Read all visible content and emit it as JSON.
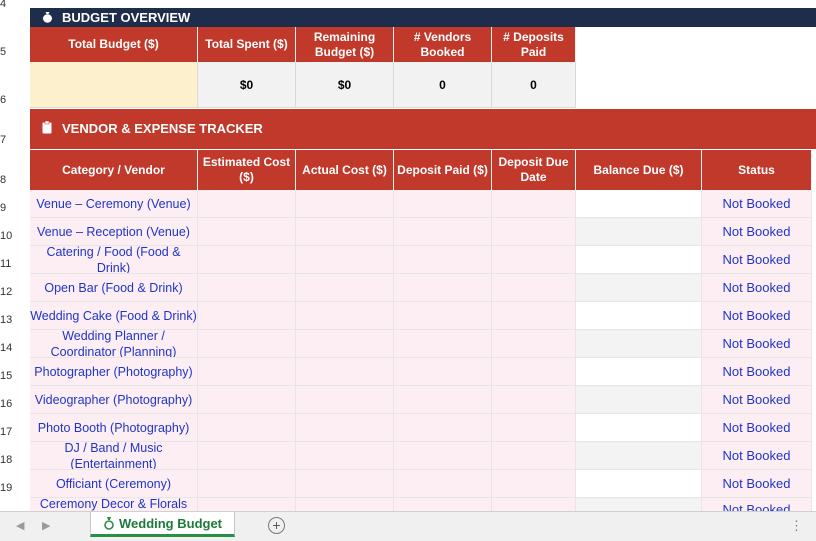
{
  "row_numbers": [
    "4",
    "5",
    "6",
    "7",
    "8",
    "9",
    "10",
    "11",
    "12",
    "13",
    "14",
    "15",
    "16",
    "17",
    "18",
    "19"
  ],
  "budget_overview": {
    "title": "BUDGET OVERVIEW",
    "icon": "money-bag-icon",
    "headers": [
      "Total Budget ($)",
      "Total Spent ($)",
      "Remaining Budget ($)",
      "# Vendors Booked",
      "# Deposits Paid"
    ],
    "values": [
      "",
      "$0",
      "$0",
      "0",
      "0"
    ]
  },
  "vendor_tracker": {
    "title": "VENDOR & EXPENSE TRACKER",
    "icon": "clipboard-icon",
    "headers": [
      "Category / Vendor",
      "Estimated Cost ($)",
      "Actual Cost ($)",
      "Deposit Paid ($)",
      "Deposit Due Date",
      "Balance Due ($)",
      "Status"
    ],
    "rows": [
      {
        "category": "Venue – Ceremony (Venue)",
        "status": "Not Booked"
      },
      {
        "category": "Venue – Reception (Venue)",
        "status": "Not Booked"
      },
      {
        "category": "Catering / Food (Food & Drink)",
        "status": "Not Booked"
      },
      {
        "category": "Open Bar (Food & Drink)",
        "status": "Not Booked"
      },
      {
        "category": "Wedding Cake (Food & Drink)",
        "status": "Not Booked"
      },
      {
        "category": "Wedding Planner / Coordinator (Planning)",
        "status": "Not Booked"
      },
      {
        "category": "Photographer (Photography)",
        "status": "Not Booked"
      },
      {
        "category": "Videographer (Photography)",
        "status": "Not Booked"
      },
      {
        "category": "Photo Booth (Photography)",
        "status": "Not Booked"
      },
      {
        "category": "DJ / Band / Music (Entertainment)",
        "status": "Not Booked"
      },
      {
        "category": "Officiant (Ceremony)",
        "status": "Not Booked"
      },
      {
        "category": "Ceremony Decor & Florals",
        "status": "Not Booked"
      }
    ]
  },
  "sheet_tabs": {
    "active": "Wedding Budget",
    "icon": "ring-icon",
    "add_icon": "plus-circle-icon"
  },
  "colors": {
    "navy": "#1f2d4d",
    "red": "#c0392b",
    "pink": "#fdeef3",
    "link_blue": "#1f35c9",
    "tab_green": "#2a8f46"
  }
}
